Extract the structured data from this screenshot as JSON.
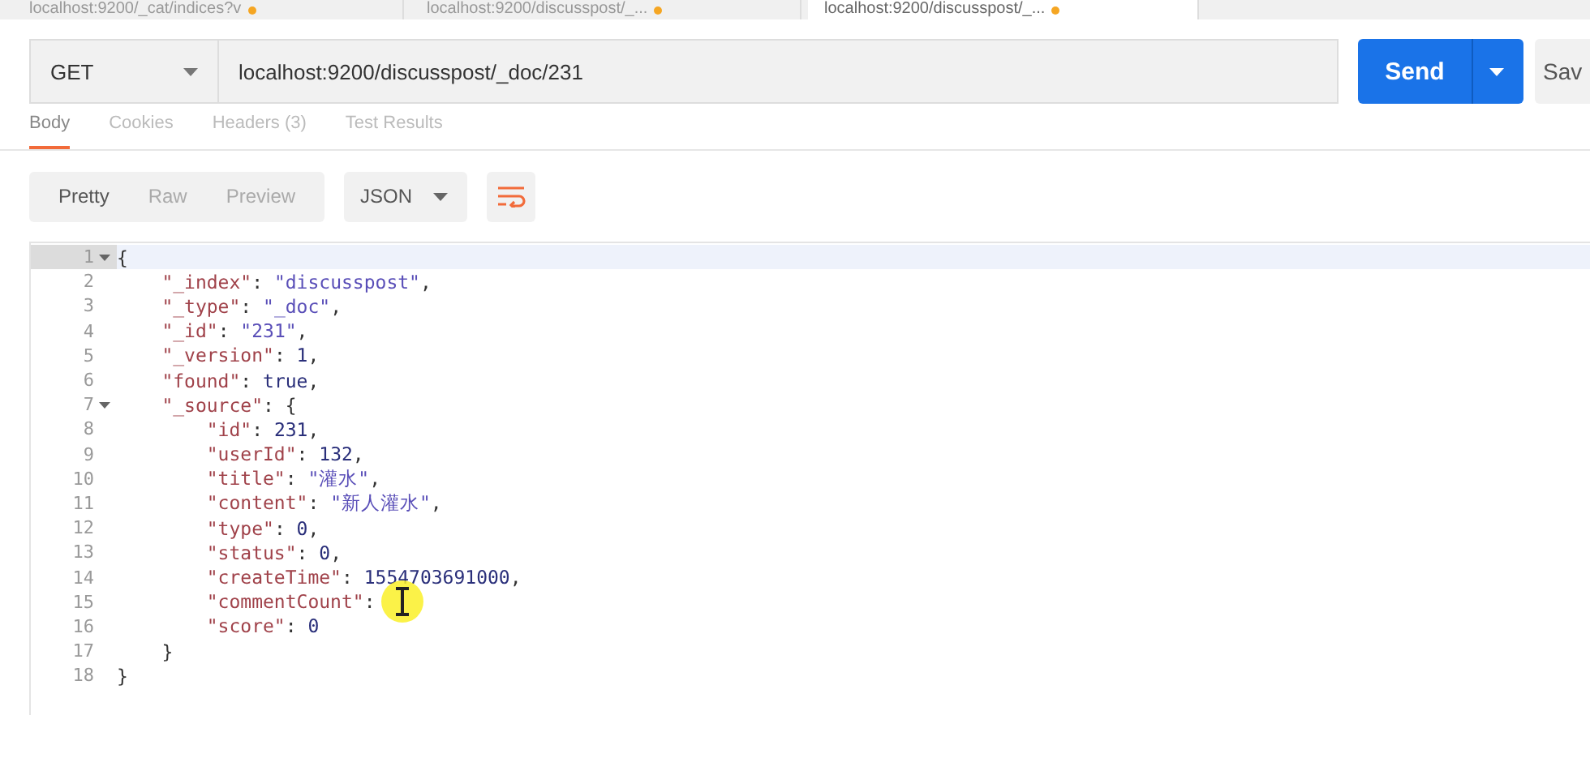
{
  "request_tabs": [
    {
      "label": "localhost:9200/_cat/indices?v",
      "unsaved": true,
      "selected": false
    },
    {
      "label": "localhost:9200/discusspost/_...",
      "unsaved": true,
      "selected": false
    },
    {
      "label": "localhost:9200/discusspost/_...",
      "unsaved": true,
      "selected": true
    }
  ],
  "request": {
    "method": "GET",
    "url": "localhost:9200/discusspost/_doc/231",
    "send": "Send",
    "save": "Sav"
  },
  "response_tabs": [
    {
      "label": "Body",
      "selected": true
    },
    {
      "label": "Cookies",
      "selected": false
    },
    {
      "label": "Headers (3)",
      "selected": false
    },
    {
      "label": "Test Results",
      "selected": false
    }
  ],
  "view_modes": [
    {
      "label": "Pretty",
      "selected": true
    },
    {
      "label": "Raw",
      "selected": false
    },
    {
      "label": "Preview",
      "selected": false
    }
  ],
  "format": "JSON",
  "lines": [
    {
      "no": "1",
      "fold": true,
      "active": true,
      "code": [
        {
          "kind": "punct",
          "text": "{"
        }
      ]
    },
    {
      "no": "2",
      "fold": false,
      "active": false,
      "code": [
        {
          "kind": "key",
          "text": "    \"_index\""
        },
        {
          "kind": "punct",
          "text": ": "
        },
        {
          "kind": "string",
          "text": "\"discusspost\""
        },
        {
          "kind": "punct",
          "text": ","
        }
      ]
    },
    {
      "no": "3",
      "fold": false,
      "active": false,
      "code": [
        {
          "kind": "key",
          "text": "    \"_type\""
        },
        {
          "kind": "punct",
          "text": ": "
        },
        {
          "kind": "string",
          "text": "\"_doc\""
        },
        {
          "kind": "punct",
          "text": ","
        }
      ]
    },
    {
      "no": "4",
      "fold": false,
      "active": false,
      "code": [
        {
          "kind": "key",
          "text": "    \"_id\""
        },
        {
          "kind": "punct",
          "text": ": "
        },
        {
          "kind": "string",
          "text": "\"231\""
        },
        {
          "kind": "punct",
          "text": ","
        }
      ]
    },
    {
      "no": "5",
      "fold": false,
      "active": false,
      "code": [
        {
          "kind": "key",
          "text": "    \"_version\""
        },
        {
          "kind": "punct",
          "text": ": "
        },
        {
          "kind": "number",
          "text": "1"
        },
        {
          "kind": "punct",
          "text": ","
        }
      ]
    },
    {
      "no": "6",
      "fold": false,
      "active": false,
      "code": [
        {
          "kind": "key",
          "text": "    \"found\""
        },
        {
          "kind": "punct",
          "text": ": "
        },
        {
          "kind": "number",
          "text": "true"
        },
        {
          "kind": "punct",
          "text": ","
        }
      ]
    },
    {
      "no": "7",
      "fold": true,
      "active": false,
      "code": [
        {
          "kind": "key",
          "text": "    \"_source\""
        },
        {
          "kind": "punct",
          "text": ": {"
        }
      ]
    },
    {
      "no": "8",
      "fold": false,
      "active": false,
      "code": [
        {
          "kind": "key",
          "text": "        \"id\""
        },
        {
          "kind": "punct",
          "text": ": "
        },
        {
          "kind": "number",
          "text": "231"
        },
        {
          "kind": "punct",
          "text": ","
        }
      ]
    },
    {
      "no": "9",
      "fold": false,
      "active": false,
      "code": [
        {
          "kind": "key",
          "text": "        \"userId\""
        },
        {
          "kind": "punct",
          "text": ": "
        },
        {
          "kind": "number",
          "text": "132"
        },
        {
          "kind": "punct",
          "text": ","
        }
      ]
    },
    {
      "no": "10",
      "fold": false,
      "active": false,
      "code": [
        {
          "kind": "key",
          "text": "        \"title\""
        },
        {
          "kind": "punct",
          "text": ": "
        },
        {
          "kind": "string",
          "text": "\"灌水\""
        },
        {
          "kind": "punct",
          "text": ","
        }
      ]
    },
    {
      "no": "11",
      "fold": false,
      "active": false,
      "code": [
        {
          "kind": "key",
          "text": "        \"content\""
        },
        {
          "kind": "punct",
          "text": ": "
        },
        {
          "kind": "string",
          "text": "\"新人灌水\""
        },
        {
          "kind": "punct",
          "text": ","
        }
      ]
    },
    {
      "no": "12",
      "fold": false,
      "active": false,
      "code": [
        {
          "kind": "key",
          "text": "        \"type\""
        },
        {
          "kind": "punct",
          "text": ": "
        },
        {
          "kind": "number",
          "text": "0"
        },
        {
          "kind": "punct",
          "text": ","
        }
      ]
    },
    {
      "no": "13",
      "fold": false,
      "active": false,
      "code": [
        {
          "kind": "key",
          "text": "        \"status\""
        },
        {
          "kind": "punct",
          "text": ": "
        },
        {
          "kind": "number",
          "text": "0"
        },
        {
          "kind": "punct",
          "text": ","
        }
      ]
    },
    {
      "no": "14",
      "fold": false,
      "active": false,
      "code": [
        {
          "kind": "key",
          "text": "        \"createTime\""
        },
        {
          "kind": "punct",
          "text": ": "
        },
        {
          "kind": "number",
          "text": "1554703691000"
        },
        {
          "kind": "punct",
          "text": ","
        }
      ]
    },
    {
      "no": "15",
      "fold": false,
      "active": false,
      "code": [
        {
          "kind": "key",
          "text": "        \"commentCount\""
        },
        {
          "kind": "punct",
          "text": ":"
        }
      ]
    },
    {
      "no": "16",
      "fold": false,
      "active": false,
      "code": [
        {
          "kind": "key",
          "text": "        \"score\""
        },
        {
          "kind": "punct",
          "text": ": "
        },
        {
          "kind": "number",
          "text": "0"
        }
      ]
    },
    {
      "no": "17",
      "fold": false,
      "active": false,
      "code": [
        {
          "kind": "punct",
          "text": "    }"
        }
      ]
    },
    {
      "no": "18",
      "fold": false,
      "active": false,
      "code": [
        {
          "kind": "punct",
          "text": "}"
        }
      ]
    }
  ]
}
